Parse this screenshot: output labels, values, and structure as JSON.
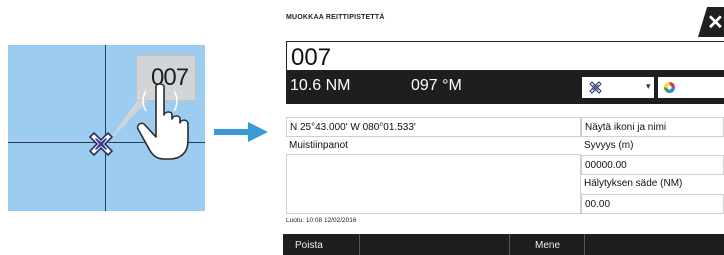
{
  "illustration": {
    "callout_label": "007",
    "tap_count": "x1"
  },
  "dialog": {
    "title": "MUOKKAA REITTIPISTETTÄ",
    "waypoint_name": "007",
    "distance": "10.6 NM",
    "bearing": "097 °M",
    "position": "N 25°43.000'  W 080°01.533'",
    "notes_label": "Muistiinpanot",
    "notes_value": "",
    "show_option": "Näytä ikoni ja nimi",
    "depth_label": "Syvyys (m)",
    "depth_value": "00000.00",
    "alarm_radius_label": "Hälytyksen säde (NM)",
    "alarm_radius_value": "00.00",
    "created": "Luotu: 10:08  12/02/2016",
    "delete_button": "Poista",
    "goto_button": "Mene"
  },
  "colors": {
    "map_water": "#9ccdf0",
    "bar_dark": "#1e1e1e",
    "arrow_blue": "#3a9ad9"
  }
}
